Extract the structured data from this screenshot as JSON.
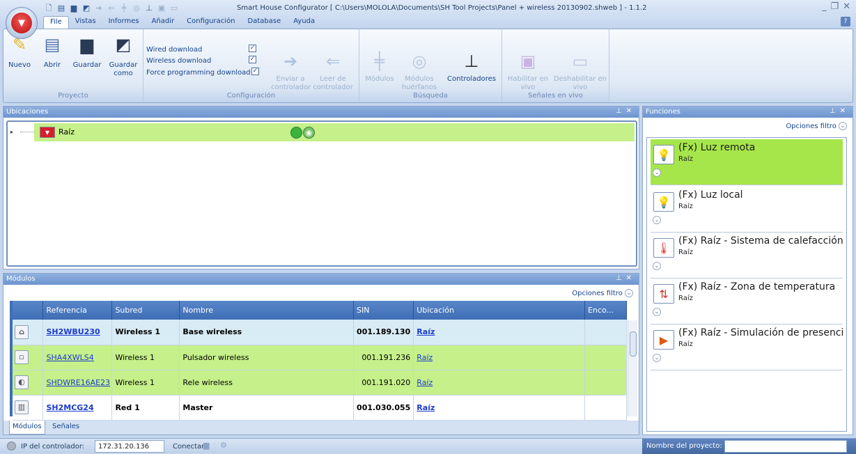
{
  "window": {
    "title": "Smart House Configurator [ C:\\Users\\MOLOLA\\Documents\\SH Tool Projects\\Panel + wireless 20130902.shweb ] - 1.1.2",
    "help_label": "?"
  },
  "menu_tabs": [
    "File",
    "Vistas",
    "Informes",
    "Añadir",
    "Configuración",
    "Database",
    "Ayuda"
  ],
  "ribbon": {
    "proyecto": {
      "title": "Proyecto",
      "nuevo": "Nuevo",
      "abrir": "Abrir",
      "guardar": "Guardar",
      "guardar_como_1": "Guardar",
      "guardar_como_2": "como"
    },
    "configuracion": {
      "title": "Configuración",
      "wired_download": "Wired download",
      "wireless_download": "Wireless download",
      "force_download": "Force programming download",
      "enviar_1": "Enviar a",
      "enviar_2": "controlador",
      "leer_1": "Leer de",
      "leer_2": "controlador"
    },
    "busqueda": {
      "title": "Búsqueda",
      "modulos": "Módulos",
      "huerfanos_1": "Módulos",
      "huerfanos_2": "huérfanos",
      "controladores": "Controladores"
    },
    "senales": {
      "title": "Señales en vivo",
      "habilitar_1": "Habilitar en",
      "habilitar_2": "vivo",
      "deshabilitar_1": "Deshabilitar en",
      "deshabilitar_2": "vivo"
    }
  },
  "ubicaciones": {
    "title": "Ubicaciones",
    "root_label": "Raíz",
    "status_color": "#3cb43c"
  },
  "modulos": {
    "title": "Módulos",
    "filter": "Opciones filtro",
    "columns": [
      "Referencia",
      "Subred",
      "Nombre",
      "SIN",
      "Ubicación",
      "Enco..."
    ],
    "rows": [
      {
        "ref": "SH2WBU230",
        "subred": "Wireless 1",
        "nombre": "Base wireless",
        "sin": "001.189.130",
        "ubic": "Raíz"
      },
      {
        "ref": "SHA4XWLS4",
        "subred": "Wireless 1",
        "nombre": "Pulsador wireless",
        "sin": "001.191.236",
        "ubic": "Raíz"
      },
      {
        "ref": "SHDWRE16AE23",
        "subred": "Wireless 1",
        "nombre": "Rele wireless",
        "sin": "001.191.020",
        "ubic": "Raíz"
      },
      {
        "ref": "SH2MCG24",
        "subred": "Red 1",
        "nombre": "Master",
        "sin": "001.030.055",
        "ubic": "Raíz"
      }
    ],
    "tabs": [
      "Módulos",
      "Señales"
    ]
  },
  "funciones": {
    "title": "Funciones",
    "filter": "Opciones filtro",
    "items": [
      {
        "name": "(Fx) Luz remota",
        "loc": "Raíz"
      },
      {
        "name": "(Fx) Luz local",
        "loc": "Raíz"
      },
      {
        "name": "(Fx) Raíz - Sistema de calefacción",
        "loc": "Raíz"
      },
      {
        "name": "(Fx) Raíz - Zona de temperatura",
        "loc": "Raíz"
      },
      {
        "name": "(Fx) Raíz - Simulación de presencia",
        "loc": "Raíz"
      }
    ]
  },
  "status": {
    "ip_label": "IP del controlador:",
    "ip_value": "172.31.20.136",
    "conectar": "Conectar",
    "project_label": "Nombre del proyecto:"
  },
  "colors": {
    "selected_green": "#a6e64a",
    "row_green": "#c5f08a",
    "header_blue": "#3f6eb6"
  }
}
